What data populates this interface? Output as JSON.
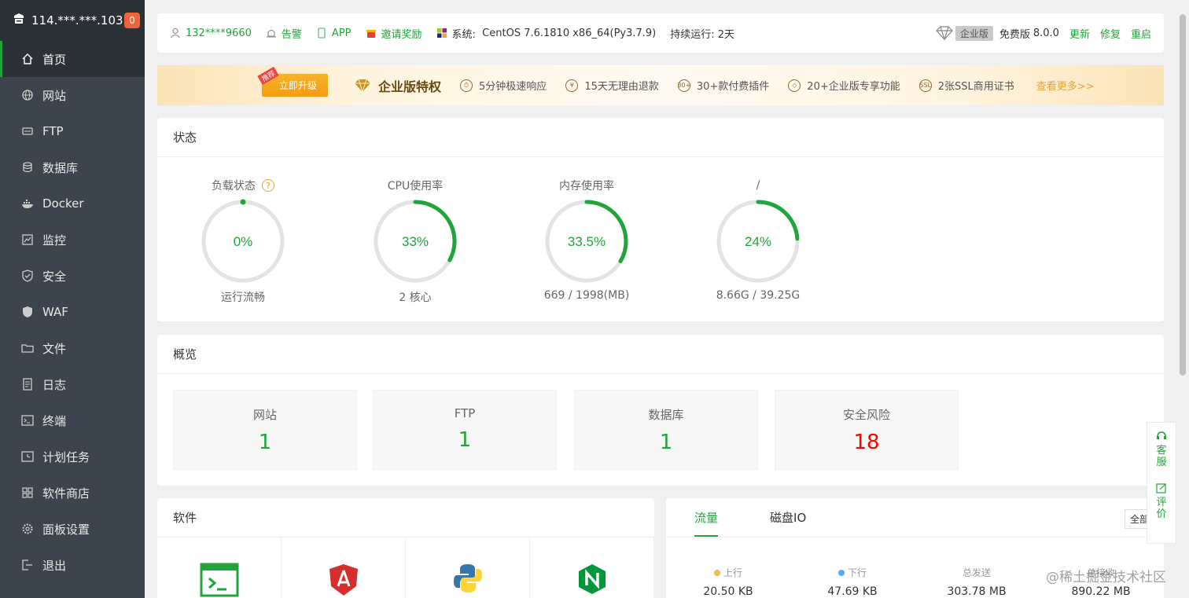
{
  "sidebar": {
    "ip": "114.***.***.103",
    "badge": "0",
    "items": [
      {
        "label": "首页",
        "icon": "home-icon"
      },
      {
        "label": "网站",
        "icon": "globe-icon"
      },
      {
        "label": "FTP",
        "icon": "ftp-icon"
      },
      {
        "label": "数据库",
        "icon": "database-icon"
      },
      {
        "label": "Docker",
        "icon": "docker-icon"
      },
      {
        "label": "监控",
        "icon": "monitor-icon"
      },
      {
        "label": "安全",
        "icon": "shield-icon"
      },
      {
        "label": "WAF",
        "icon": "waf-icon"
      },
      {
        "label": "文件",
        "icon": "folder-icon"
      },
      {
        "label": "日志",
        "icon": "log-icon"
      },
      {
        "label": "终端",
        "icon": "terminal-icon"
      },
      {
        "label": "计划任务",
        "icon": "clock-icon"
      },
      {
        "label": "软件商店",
        "icon": "grid-icon"
      },
      {
        "label": "面板设置",
        "icon": "gear-icon"
      },
      {
        "label": "退出",
        "icon": "logout-icon"
      }
    ]
  },
  "topbar": {
    "user": "132****9660",
    "alarm": "告警",
    "app": "APP",
    "invite": "邀请奖励",
    "system_label": "系统:",
    "system_value": "CentOS 7.6.1810 x86_64(Py3.7.9)",
    "uptime": "持续运行: 2天",
    "enterprise": "企业版",
    "free_version": "免费版",
    "version": "8.0.0",
    "update": "更新",
    "repair": "修复",
    "restart": "重启"
  },
  "banner": {
    "recommend": "推荐",
    "upgrade": "立即升级",
    "title": "企业版特权",
    "benefits": [
      "5分钟极速响应",
      "15天无理由退款",
      "30+款付费插件",
      "20+企业版专享功能",
      "2张SSL商用证书"
    ],
    "more": "查看更多>>"
  },
  "status": {
    "title": "状态",
    "gauges": [
      {
        "title": "负载状态",
        "value": "0%",
        "fraction": 0.0,
        "sub": "运行流畅",
        "help": "?"
      },
      {
        "title": "CPU使用率",
        "value": "33%",
        "fraction": 0.33,
        "sub": "2 核心"
      },
      {
        "title": "内存使用率",
        "value": "33.5%",
        "fraction": 0.335,
        "sub": "669 / 1998(MB)"
      },
      {
        "title": "/",
        "value": "24%",
        "fraction": 0.24,
        "sub": "8.66G / 39.25G"
      }
    ]
  },
  "overview": {
    "title": "概览",
    "items": [
      {
        "label": "网站",
        "value": "1"
      },
      {
        "label": "FTP",
        "value": "1"
      },
      {
        "label": "数据库",
        "value": "1"
      },
      {
        "label": "安全风险",
        "value": "18"
      }
    ]
  },
  "software": {
    "title": "软件"
  },
  "flow": {
    "tabs": [
      "流量",
      "磁盘IO"
    ],
    "all": "全部",
    "stats": [
      {
        "label": "上行",
        "value": "20.50 KB",
        "color": "#f7b851"
      },
      {
        "label": "下行",
        "value": "47.69 KB",
        "color": "#52a9ff"
      },
      {
        "label": "总发送",
        "value": "303.78 MB"
      },
      {
        "label": "总接收",
        "value": "890.22 MB"
      }
    ]
  },
  "float": {
    "service": "客服",
    "rate": "评价"
  },
  "watermark": "@稀土掘金技术社区",
  "colors": {
    "accent": "#20a53a",
    "sidebar": "#3c444d",
    "danger": "#ff0000"
  }
}
